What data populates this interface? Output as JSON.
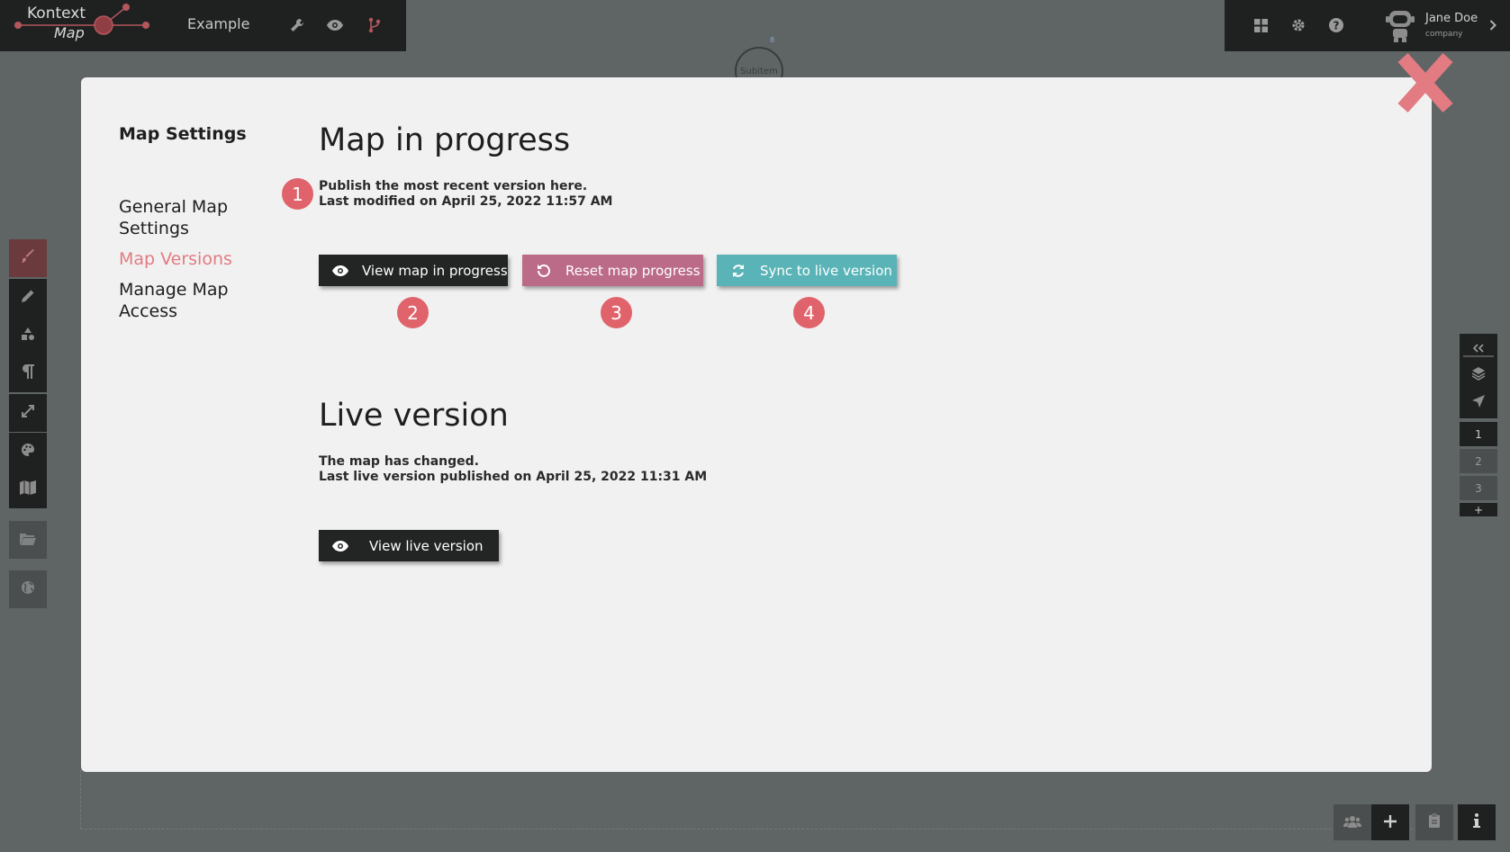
{
  "app": {
    "logo_line1": "Kontext",
    "logo_line2": "Map",
    "map_name": "Example"
  },
  "user": {
    "name": "Jane Doe",
    "company": "company"
  },
  "canvas": {
    "subitem_label": "Subitem",
    "subitem_count": "8"
  },
  "pages": [
    "1",
    "2",
    "3"
  ],
  "pages_add": "+",
  "modal": {
    "settings_title": "Map Settings",
    "nav": {
      "general": "General Map Settings",
      "versions": "Map Versions",
      "access": "Manage Map Access"
    },
    "progress": {
      "title": "Map in progress",
      "line1": "Publish the most recent version here.",
      "line2": "Last modified on April 25, 2022 11:57 AM",
      "view_button": "View map in progress",
      "reset_button": "Reset map progress",
      "sync_button": "Sync to live version"
    },
    "live": {
      "title": "Live version",
      "line1": "The map has changed.",
      "line2": "Last live version published on April 25, 2022 11:31 AM",
      "view_button": "View live version"
    }
  },
  "badges": [
    "1",
    "2",
    "3",
    "4"
  ],
  "colors": {
    "accent": "#e27b82",
    "badge": "#e0636b",
    "reset_button": "#bb6b88",
    "sync_button": "#5ab4b7",
    "dark": "#1f2121"
  },
  "icons": {
    "top_toolbar": [
      "wrench-icon",
      "eye-icon",
      "branch-icon"
    ],
    "top_right": [
      "grid-icon",
      "gear-icon",
      "help-icon",
      "robot-avatar-icon",
      "chevron-right-icon"
    ],
    "left_toolbar": [
      "brush-icon",
      "pencil-icon",
      "shapes-icon",
      "paragraph-icon",
      "resize-icon",
      "palette-icon",
      "map-icon",
      "folder-icon",
      "globe-icon"
    ],
    "right_toolbar": [
      "double-chevron-left-icon",
      "layers-icon",
      "location-arrow-icon"
    ],
    "bottom_right": [
      "users-icon",
      "plus-icon",
      "clipboard-icon",
      "info-icon"
    ]
  }
}
